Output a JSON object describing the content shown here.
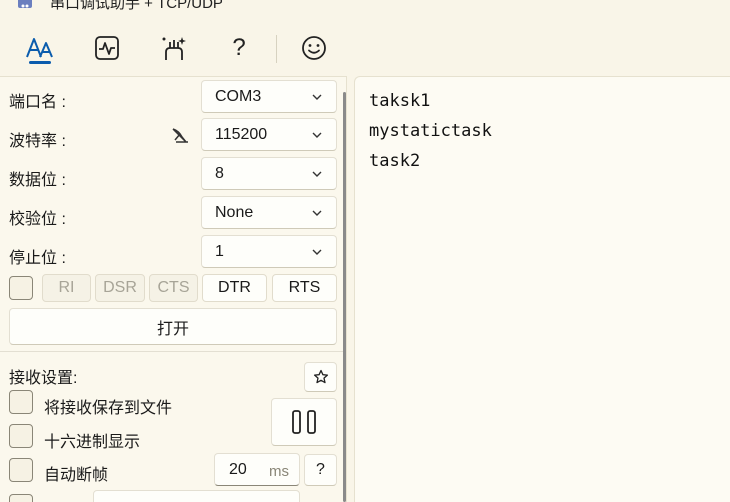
{
  "window": {
    "title": "串口调试助手 + TCP/UDP"
  },
  "toolbar": {
    "icons": [
      "text-style-icon",
      "waveform-icon",
      "sparkle-icon",
      "help-icon",
      "smiley-icon"
    ],
    "help_glyph": "?"
  },
  "serial": {
    "port_label": "端口名 :",
    "port_value": "COM3",
    "baud_label": "波特率 :",
    "baud_value": "115200",
    "databits_label": "数据位 :",
    "databits_value": "8",
    "parity_label": "校验位 :",
    "parity_value": "None",
    "stopbits_label": "停止位 :",
    "stopbits_value": "1",
    "pins": [
      {
        "label": "RI",
        "enabled": false
      },
      {
        "label": "DSR",
        "enabled": false
      },
      {
        "label": "CTS",
        "enabled": false
      },
      {
        "label": "DTR",
        "enabled": true
      },
      {
        "label": "RTS",
        "enabled": true
      }
    ],
    "open_button": "打开"
  },
  "receive": {
    "header": "接收设置:",
    "save_to_file": "将接收保存到文件",
    "hex_display": "十六进制显示",
    "auto_frame": "自动断帧",
    "frame_ms_value": "20",
    "frame_ms_unit": "ms",
    "help_glyph": "?"
  },
  "rx_text": [
    "taksk1",
    "mystatictask",
    "task2"
  ],
  "colors": {
    "accent": "#0b5cad",
    "background": "#f9f5e8"
  }
}
